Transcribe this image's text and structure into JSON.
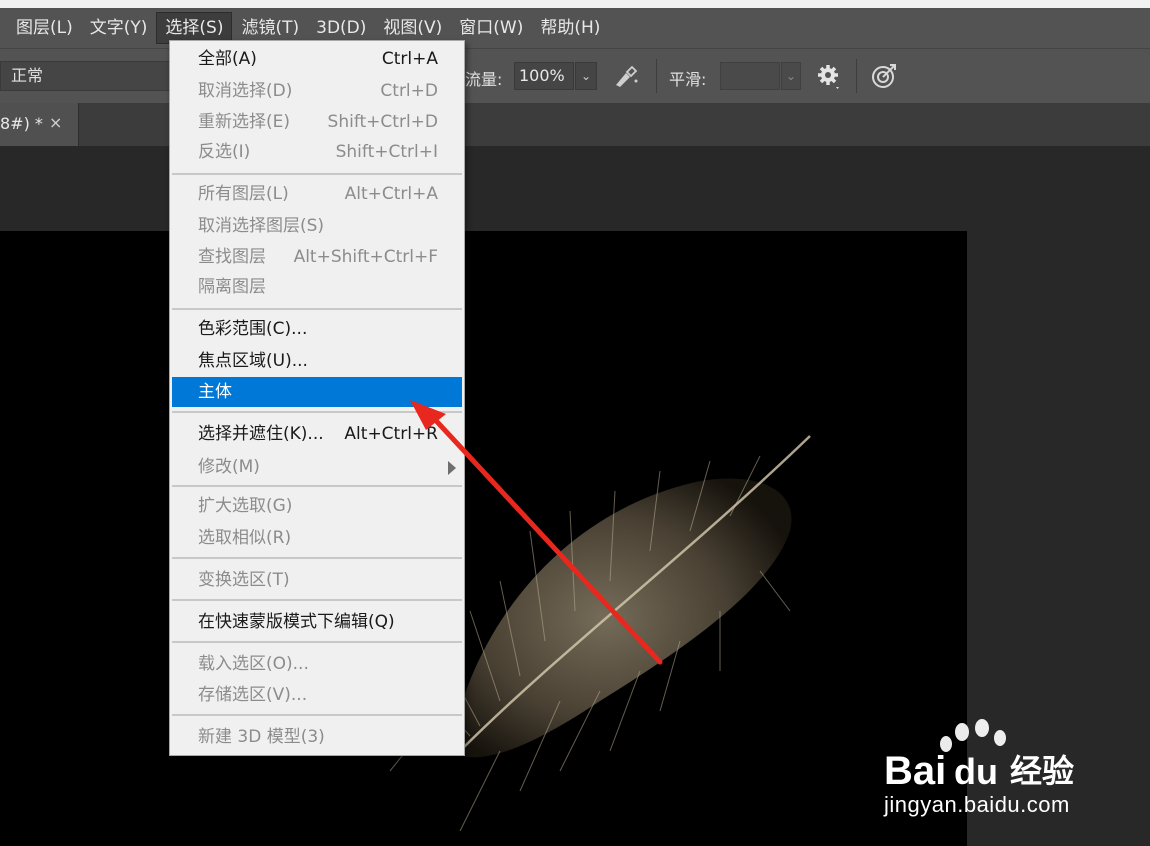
{
  "menubar": {
    "items": [
      {
        "label": "图层(L)",
        "active": false
      },
      {
        "label": "文字(Y)",
        "active": false
      },
      {
        "label": "选择(S)",
        "active": true
      },
      {
        "label": "滤镜(T)",
        "active": false
      },
      {
        "label": "3D(D)",
        "active": false
      },
      {
        "label": "视图(V)",
        "active": false
      },
      {
        "label": "窗口(W)",
        "active": false
      },
      {
        "label": "帮助(H)",
        "active": false
      }
    ]
  },
  "options": {
    "mode_value": "正常",
    "flow_label": "流量:",
    "flow_value": "100%",
    "smooth_label": "平滑:"
  },
  "document_tab": {
    "title": "8#) *",
    "close": "×"
  },
  "select_menu": {
    "items": [
      {
        "label": "全部(A)",
        "shortcut": "Ctrl+A",
        "state": "enabled"
      },
      {
        "label": "取消选择(D)",
        "shortcut": "Ctrl+D",
        "state": "disabled"
      },
      {
        "label": "重新选择(E)",
        "shortcut": "Shift+Ctrl+D",
        "state": "disabled"
      },
      {
        "label": "反选(I)",
        "shortcut": "Shift+Ctrl+I",
        "state": "disabled"
      },
      {
        "label": "所有图层(L)",
        "shortcut": "Alt+Ctrl+A",
        "state": "disabled"
      },
      {
        "label": "取消选择图层(S)",
        "shortcut": "",
        "state": "disabled"
      },
      {
        "label": "查找图层",
        "shortcut": "Alt+Shift+Ctrl+F",
        "state": "disabled"
      },
      {
        "label": "隔离图层",
        "shortcut": "",
        "state": "disabled"
      },
      {
        "label": "色彩范围(C)...",
        "shortcut": "",
        "state": "enabled"
      },
      {
        "label": "焦点区域(U)...",
        "shortcut": "",
        "state": "enabled"
      },
      {
        "label": "主体",
        "shortcut": "",
        "state": "highlight"
      },
      {
        "label": "选择并遮住(K)...",
        "shortcut": "Alt+Ctrl+R",
        "state": "enabled"
      },
      {
        "label": "修改(M)",
        "shortcut": "",
        "state": "disabled"
      },
      {
        "label": "扩大选取(G)",
        "shortcut": "",
        "state": "disabled"
      },
      {
        "label": "选取相似(R)",
        "shortcut": "",
        "state": "disabled"
      },
      {
        "label": "变换选区(T)",
        "shortcut": "",
        "state": "disabled"
      },
      {
        "label": "在快速蒙版模式下编辑(Q)",
        "shortcut": "",
        "state": "enabled"
      },
      {
        "label": "载入选区(O)...",
        "shortcut": "",
        "state": "disabled"
      },
      {
        "label": "存储选区(V)...",
        "shortcut": "",
        "state": "disabled"
      },
      {
        "label": "新建 3D 模型(3)",
        "shortcut": "",
        "state": "disabled"
      }
    ]
  },
  "watermark": {
    "brand": "Bai",
    "brand2": "du",
    "brand3": "经验",
    "url": "jingyan.baidu.com"
  },
  "colors": {
    "highlight": "#0078d7",
    "arrow": "#e8281e"
  }
}
